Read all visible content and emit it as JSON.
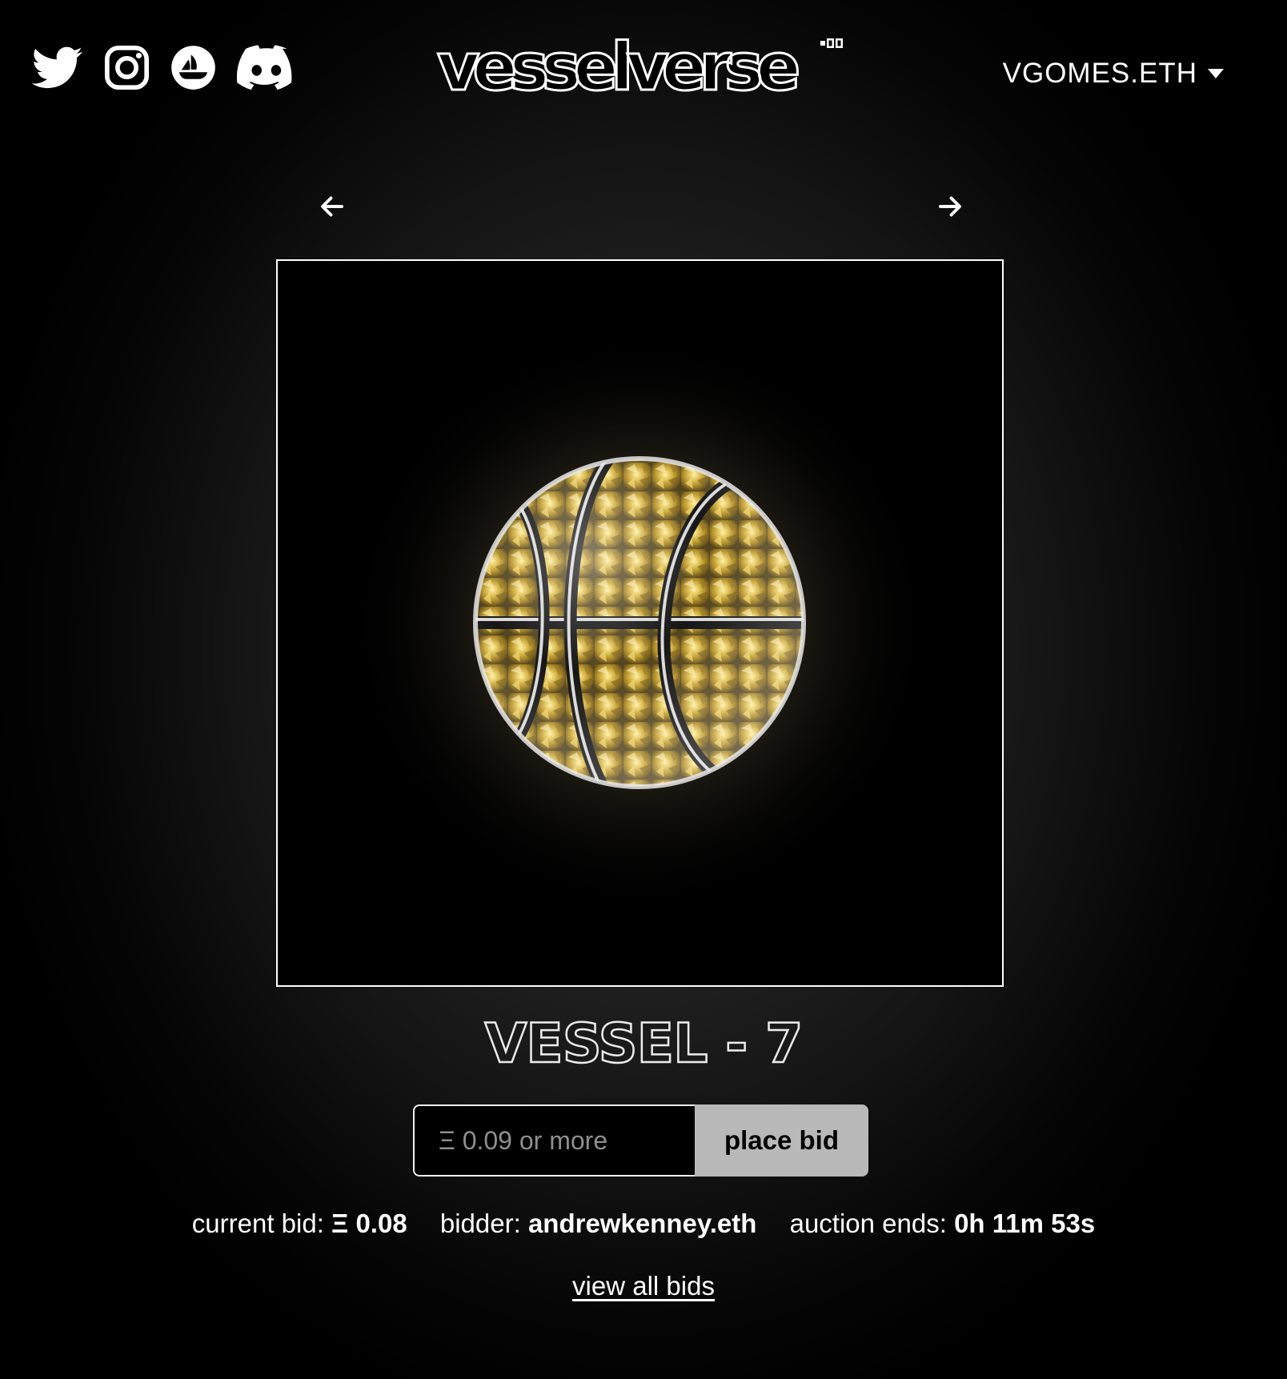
{
  "header": {
    "logo_text": "vesselverse",
    "account_name": "VGOMES.ETH",
    "social_icons": [
      "twitter-icon",
      "instagram-icon",
      "opensea-icon",
      "discord-icon"
    ]
  },
  "artwork": {
    "subject": "basketball-vessel-with-gold-flakes"
  },
  "auction": {
    "title": "VESSEL - 7",
    "bid_input_placeholder": "Ξ 0.09 or more",
    "place_bid_label": "place bid",
    "current_bid_label": "current bid:",
    "current_bid_value": "Ξ 0.08",
    "bidder_label": "bidder:",
    "bidder_value": "andrewkenney.eth",
    "ends_label": "auction ends:",
    "ends_value": "0h 11m 53s",
    "view_all_bids_label": "view all bids"
  },
  "colors": {
    "background": "#000000",
    "text": "#ffffff",
    "button_bg": "#b9b9b9",
    "placeholder": "#8e8e8e",
    "gold": "#c9a227"
  }
}
